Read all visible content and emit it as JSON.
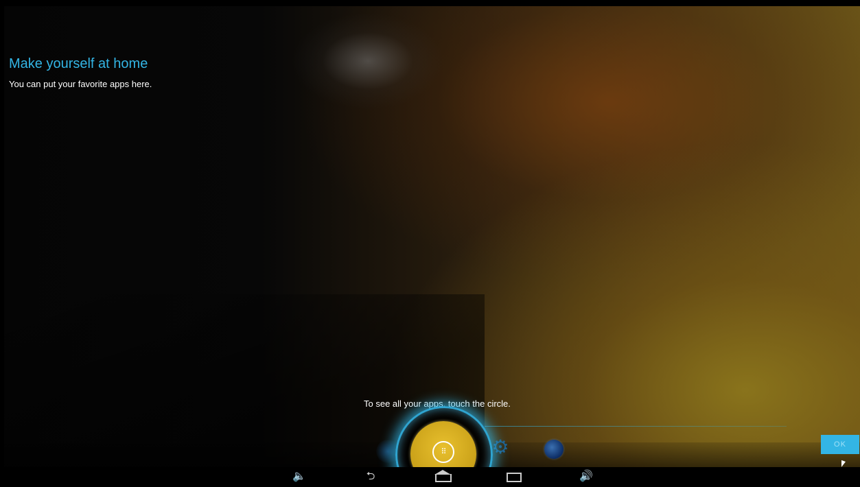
{
  "welcome": {
    "title": "Make yourself at home",
    "subtitle": "You can put your favorite apps here."
  },
  "hint": {
    "text": "To see all your apps, touch the circle."
  },
  "dock": {
    "apps_button_icon": "apps-grid-icon",
    "left_icon": "app-icon",
    "settings_icon": "settings-gear-icon",
    "browser_icon": "browser-icon"
  },
  "ok_button": {
    "label": "OK"
  },
  "navbar": {
    "volume_down": "volume-down-icon",
    "back": "back-icon",
    "home": "home-icon",
    "recents": "recent-apps-icon",
    "volume_up": "volume-up-icon"
  },
  "colors": {
    "accent": "#33b5e5",
    "apps_circle": "#d4ae20"
  }
}
